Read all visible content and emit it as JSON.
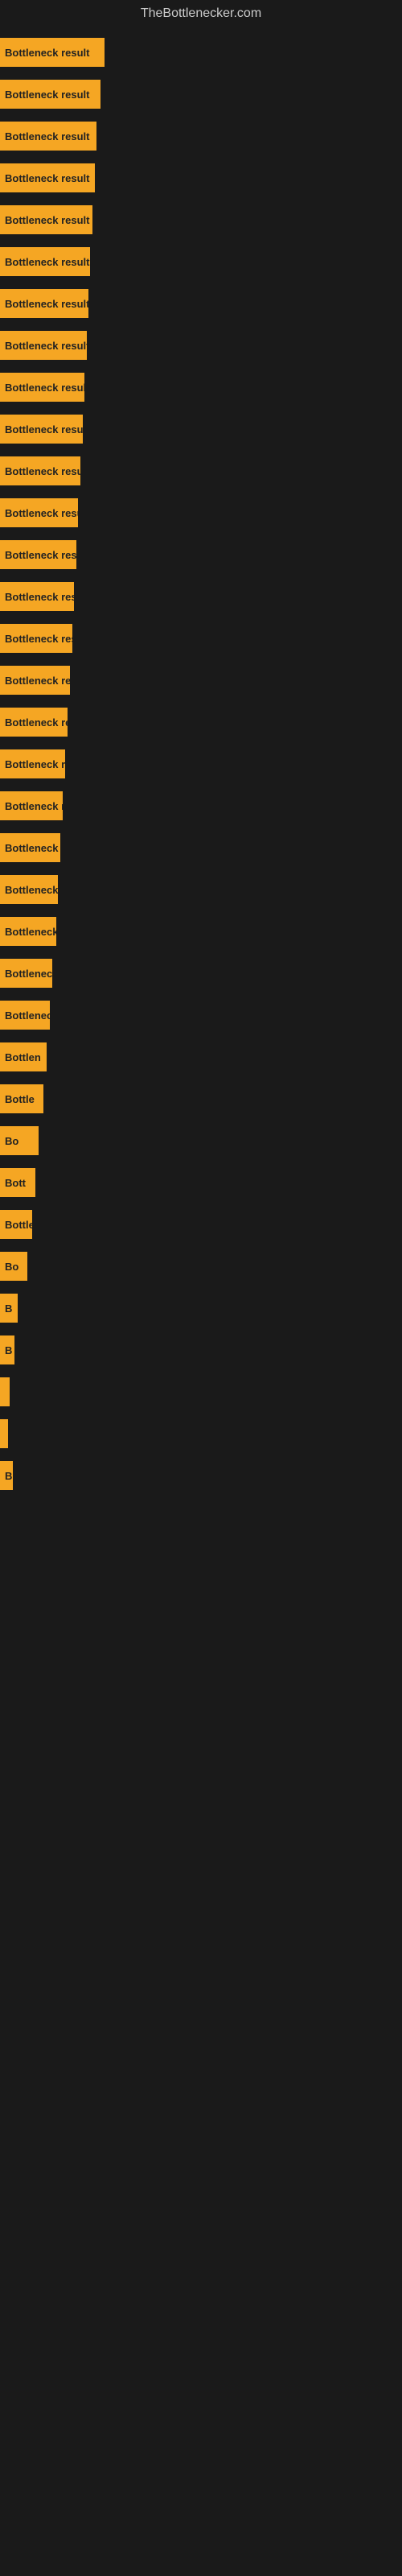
{
  "site": {
    "title": "TheBottlenecker.com"
  },
  "bars": [
    {
      "label": "Bottleneck result",
      "width": 130
    },
    {
      "label": "Bottleneck result",
      "width": 125
    },
    {
      "label": "Bottleneck result",
      "width": 120
    },
    {
      "label": "Bottleneck result",
      "width": 118
    },
    {
      "label": "Bottleneck result",
      "width": 115
    },
    {
      "label": "Bottleneck result",
      "width": 112
    },
    {
      "label": "Bottleneck result",
      "width": 110
    },
    {
      "label": "Bottleneck result",
      "width": 108
    },
    {
      "label": "Bottleneck result",
      "width": 105
    },
    {
      "label": "Bottleneck result",
      "width": 103
    },
    {
      "label": "Bottleneck result",
      "width": 100
    },
    {
      "label": "Bottleneck result",
      "width": 97
    },
    {
      "label": "Bottleneck result",
      "width": 95
    },
    {
      "label": "Bottleneck result",
      "width": 92
    },
    {
      "label": "Bottleneck result",
      "width": 90
    },
    {
      "label": "Bottleneck resul",
      "width": 87
    },
    {
      "label": "Bottleneck result",
      "width": 84
    },
    {
      "label": "Bottleneck resu",
      "width": 81
    },
    {
      "label": "Bottleneck r",
      "width": 78
    },
    {
      "label": "Bottleneck resu",
      "width": 75
    },
    {
      "label": "Bottleneck re",
      "width": 72
    },
    {
      "label": "Bottleneck result",
      "width": 70
    },
    {
      "label": "Bottleneck",
      "width": 65
    },
    {
      "label": "Bottleneck res",
      "width": 62
    },
    {
      "label": "Bottlen",
      "width": 58
    },
    {
      "label": "Bottle",
      "width": 54
    },
    {
      "label": "Bo",
      "width": 48
    },
    {
      "label": "Bott",
      "width": 44
    },
    {
      "label": "Bottlene",
      "width": 40
    },
    {
      "label": "Bo",
      "width": 34
    },
    {
      "label": "B",
      "width": 22
    },
    {
      "label": "B",
      "width": 18
    },
    {
      "label": "",
      "width": 12
    },
    {
      "label": "",
      "width": 8
    },
    {
      "label": "B",
      "width": 16
    }
  ]
}
